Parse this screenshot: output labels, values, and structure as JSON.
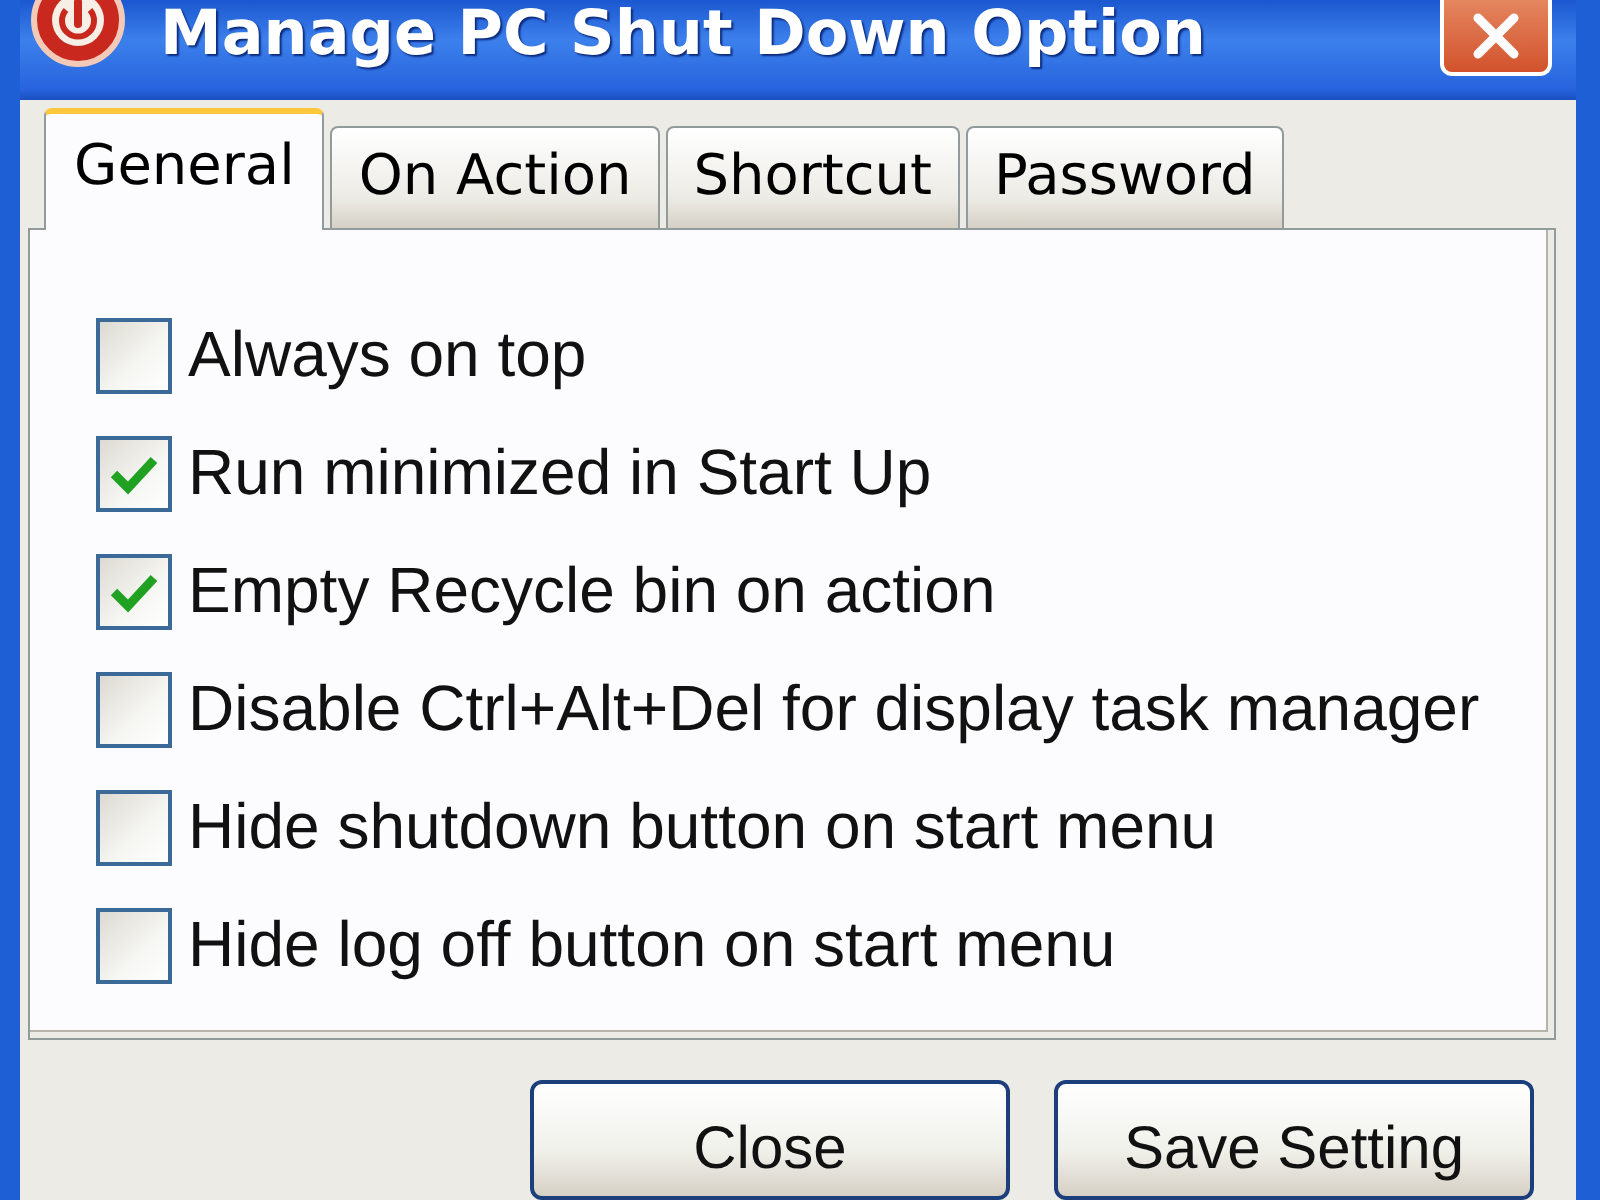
{
  "window": {
    "title": "Manage PC Shut Down Option"
  },
  "tabs": [
    {
      "label": "General",
      "selected": true
    },
    {
      "label": "On Action",
      "selected": false
    },
    {
      "label": "Shortcut",
      "selected": false
    },
    {
      "label": "Password",
      "selected": false
    }
  ],
  "options": [
    {
      "label": "Always on top",
      "checked": false
    },
    {
      "label": "Run minimized in Start Up",
      "checked": true
    },
    {
      "label": "Empty Recycle bin on action",
      "checked": true
    },
    {
      "label": "Disable Ctrl+Alt+Del for display task manager",
      "checked": false
    },
    {
      "label": "Hide shutdown button on start menu",
      "checked": false
    },
    {
      "label": "Hide log off button on start menu",
      "checked": false
    }
  ],
  "buttons": [
    "Close",
    "Save Setting"
  ]
}
